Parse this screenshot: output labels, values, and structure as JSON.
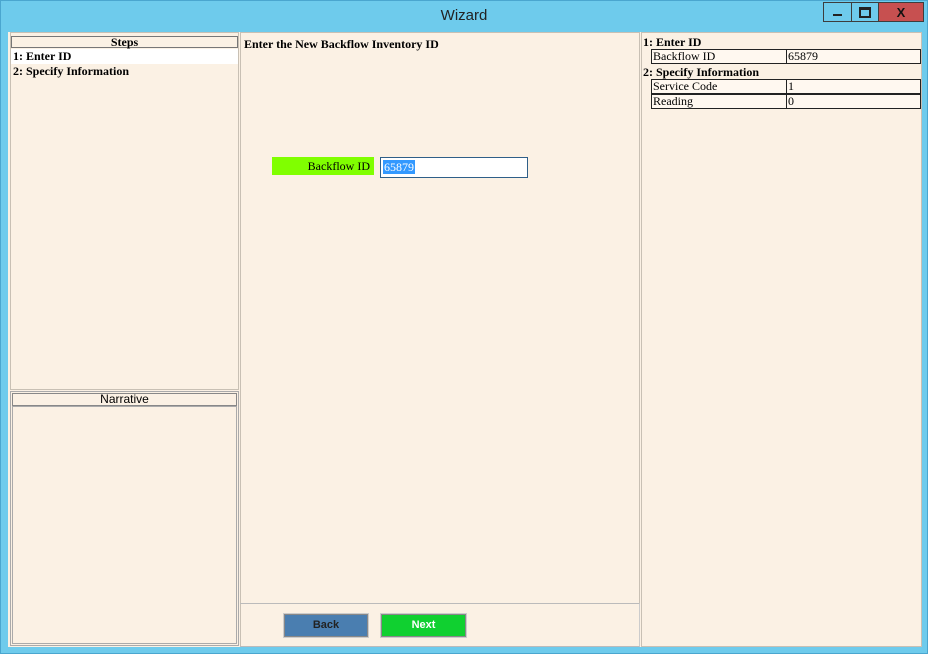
{
  "window": {
    "title": "Wizard",
    "close_glyph": "X"
  },
  "steps": {
    "header": "Steps",
    "items": [
      "1: Enter ID",
      "2: Specify Information"
    ]
  },
  "narrative": {
    "header": "Narrative"
  },
  "center": {
    "title": "Enter the New Backflow Inventory ID",
    "field_label": "Backflow ID",
    "field_value": "65879"
  },
  "buttons": {
    "back": "Back",
    "next": "Next"
  },
  "summary": {
    "section1": "1: Enter ID",
    "section1_rows": [
      {
        "key": "Backflow ID",
        "value": "65879"
      }
    ],
    "section2": "2: Specify Information",
    "section2_rows": [
      {
        "key": "Service Code",
        "value": "1"
      },
      {
        "key": "Reading",
        "value": "0"
      }
    ]
  },
  "colors": {
    "titlebar": "#6ecbec",
    "client_bg": "#fbf1e4",
    "label_highlight": "#80ff00",
    "back_button": "#4a7eb0",
    "next_button": "#10d030",
    "close_button": "#c75050"
  }
}
